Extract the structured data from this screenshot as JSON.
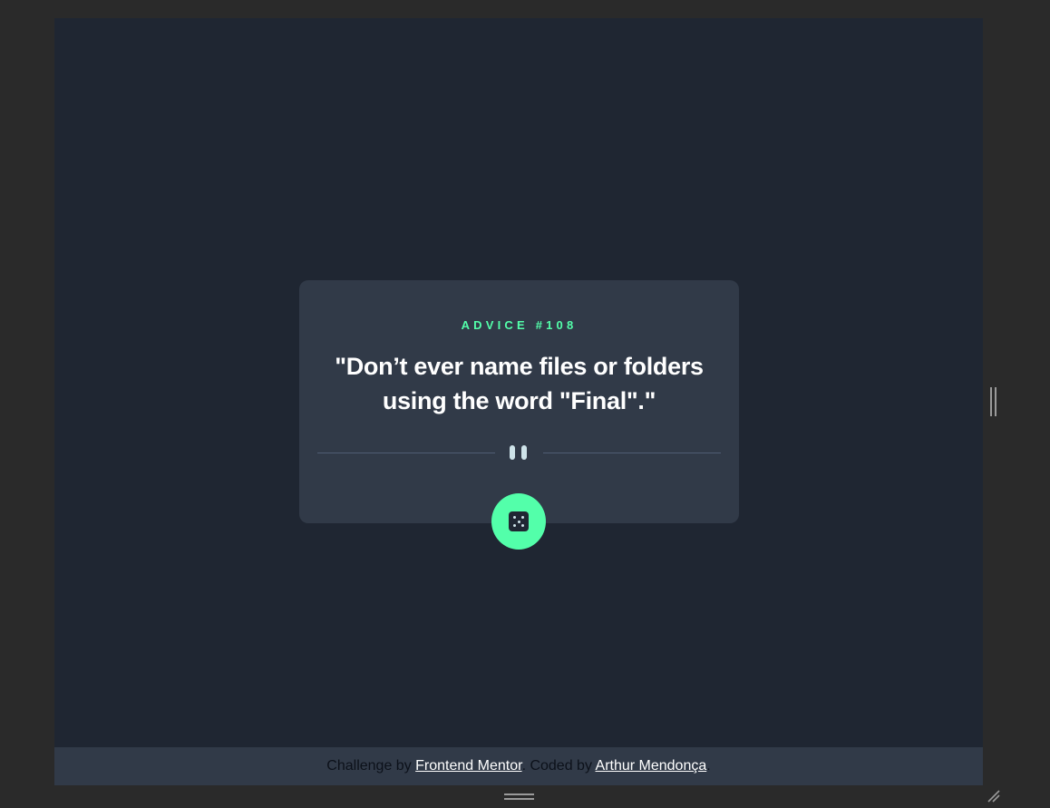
{
  "card": {
    "advice_label": "ADVICE #108",
    "advice_text": "\"Don’t ever name files or folders using the word \"Final\".\""
  },
  "footer": {
    "challenge_prefix": "Challenge by",
    "challenge_link": "Frontend Mentor",
    "coded_prefix": ". Coded by",
    "coded_link": "Arthur Mendonça",
    "suffix": "."
  },
  "icons": {
    "divider": "pause-icon",
    "button": "dice-icon",
    "handles": [
      "resize-handle-right-icon",
      "resize-handle-bottom-icon",
      "resize-corner-icon"
    ]
  },
  "colors": {
    "page_bg": "#1f2632",
    "card_bg": "#313a48",
    "accent": "#53ffaa",
    "text_light": "#cee3e9",
    "frame_bg": "#2a2a2a"
  }
}
